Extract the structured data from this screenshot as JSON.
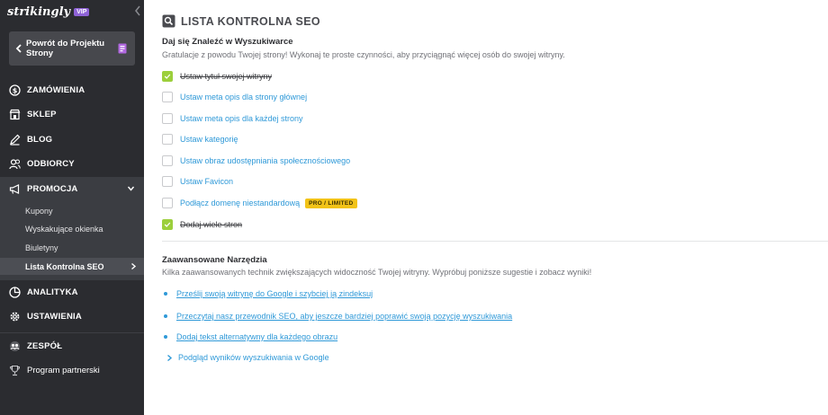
{
  "app": {
    "logo_text": "strikingly",
    "plan_badge": "VIP"
  },
  "sidebar": {
    "back_button_label": "Powrót do Projektu Strony",
    "items": [
      {
        "label": "ZAMÓWIENIA",
        "icon": "dollar-circle-icon"
      },
      {
        "label": "SKLEP",
        "icon": "store-icon"
      },
      {
        "label": "BLOG",
        "icon": "pen-icon"
      },
      {
        "label": "ODBIORCY",
        "icon": "audience-icon"
      },
      {
        "label": "PROMOCJA",
        "icon": "megaphone-icon",
        "expanded": true
      },
      {
        "label": "ANALITYKA",
        "icon": "chart-pie-icon"
      },
      {
        "label": "USTAWIENIA",
        "icon": "gear-icon"
      },
      {
        "label": "ZESPÓŁ",
        "icon": "team-icon"
      },
      {
        "label": "Program partnerski",
        "icon": "trophy-icon"
      }
    ],
    "promo_subitems": [
      {
        "label": "Kupony",
        "active": false
      },
      {
        "label": "Wyskakujące okienka",
        "active": false
      },
      {
        "label": "Biuletyny",
        "active": false
      },
      {
        "label": "Lista Kontrolna SEO",
        "active": true
      }
    ]
  },
  "main": {
    "title": "LISTA KONTROLNA SEO",
    "checklist_section": {
      "heading": "Daj się Znaleźć w Wyszukiwarce",
      "description": "Gratulacje z powodu Twojej strony! Wykonaj te proste czynności, aby przyciągnąć więcej osób do swojej witryny.",
      "items": [
        {
          "label": "Ustaw tytuł swojej witryny",
          "done": true
        },
        {
          "label": "Ustaw meta opis dla strony głównej",
          "done": false
        },
        {
          "label": "Ustaw meta opis dla każdej strony",
          "done": false
        },
        {
          "label": "Ustaw kategorię",
          "done": false
        },
        {
          "label": "Ustaw obraz udostępniania społecznościowego",
          "done": false
        },
        {
          "label": "Ustaw Favicon",
          "done": false
        },
        {
          "label": "Podłącz domenę niestandardową",
          "done": false,
          "badge": "PRO / LIMITED"
        },
        {
          "label": "Dodaj wiele stron",
          "done": true
        }
      ]
    },
    "tools_section": {
      "heading": "Zaawansowane Narzędzia",
      "description": "Kilka zaawansowanych technik zwiększających widoczność Twojej witryny. Wypróbuj poniższe sugestie i zobacz wyniki!",
      "links": [
        "Prześlij swoją witrynę do Google i szybciej ją zindeksuj",
        "Przeczytaj nasz przewodnik SEO, aby jeszcze bardziej poprawić swoją pozycję wyszukiwania",
        "Dodaj tekst alternatywny dla każdego obrazu"
      ],
      "preview_label": "Podgląd wyników wyszukiwania w Google"
    }
  },
  "colors": {
    "sidebar_bg": "#2b2c30",
    "link_blue": "#2f99d8",
    "check_green": "#9ccf3c",
    "badge_yellow": "#f2c318",
    "vip_purple": "#8f63d7"
  }
}
